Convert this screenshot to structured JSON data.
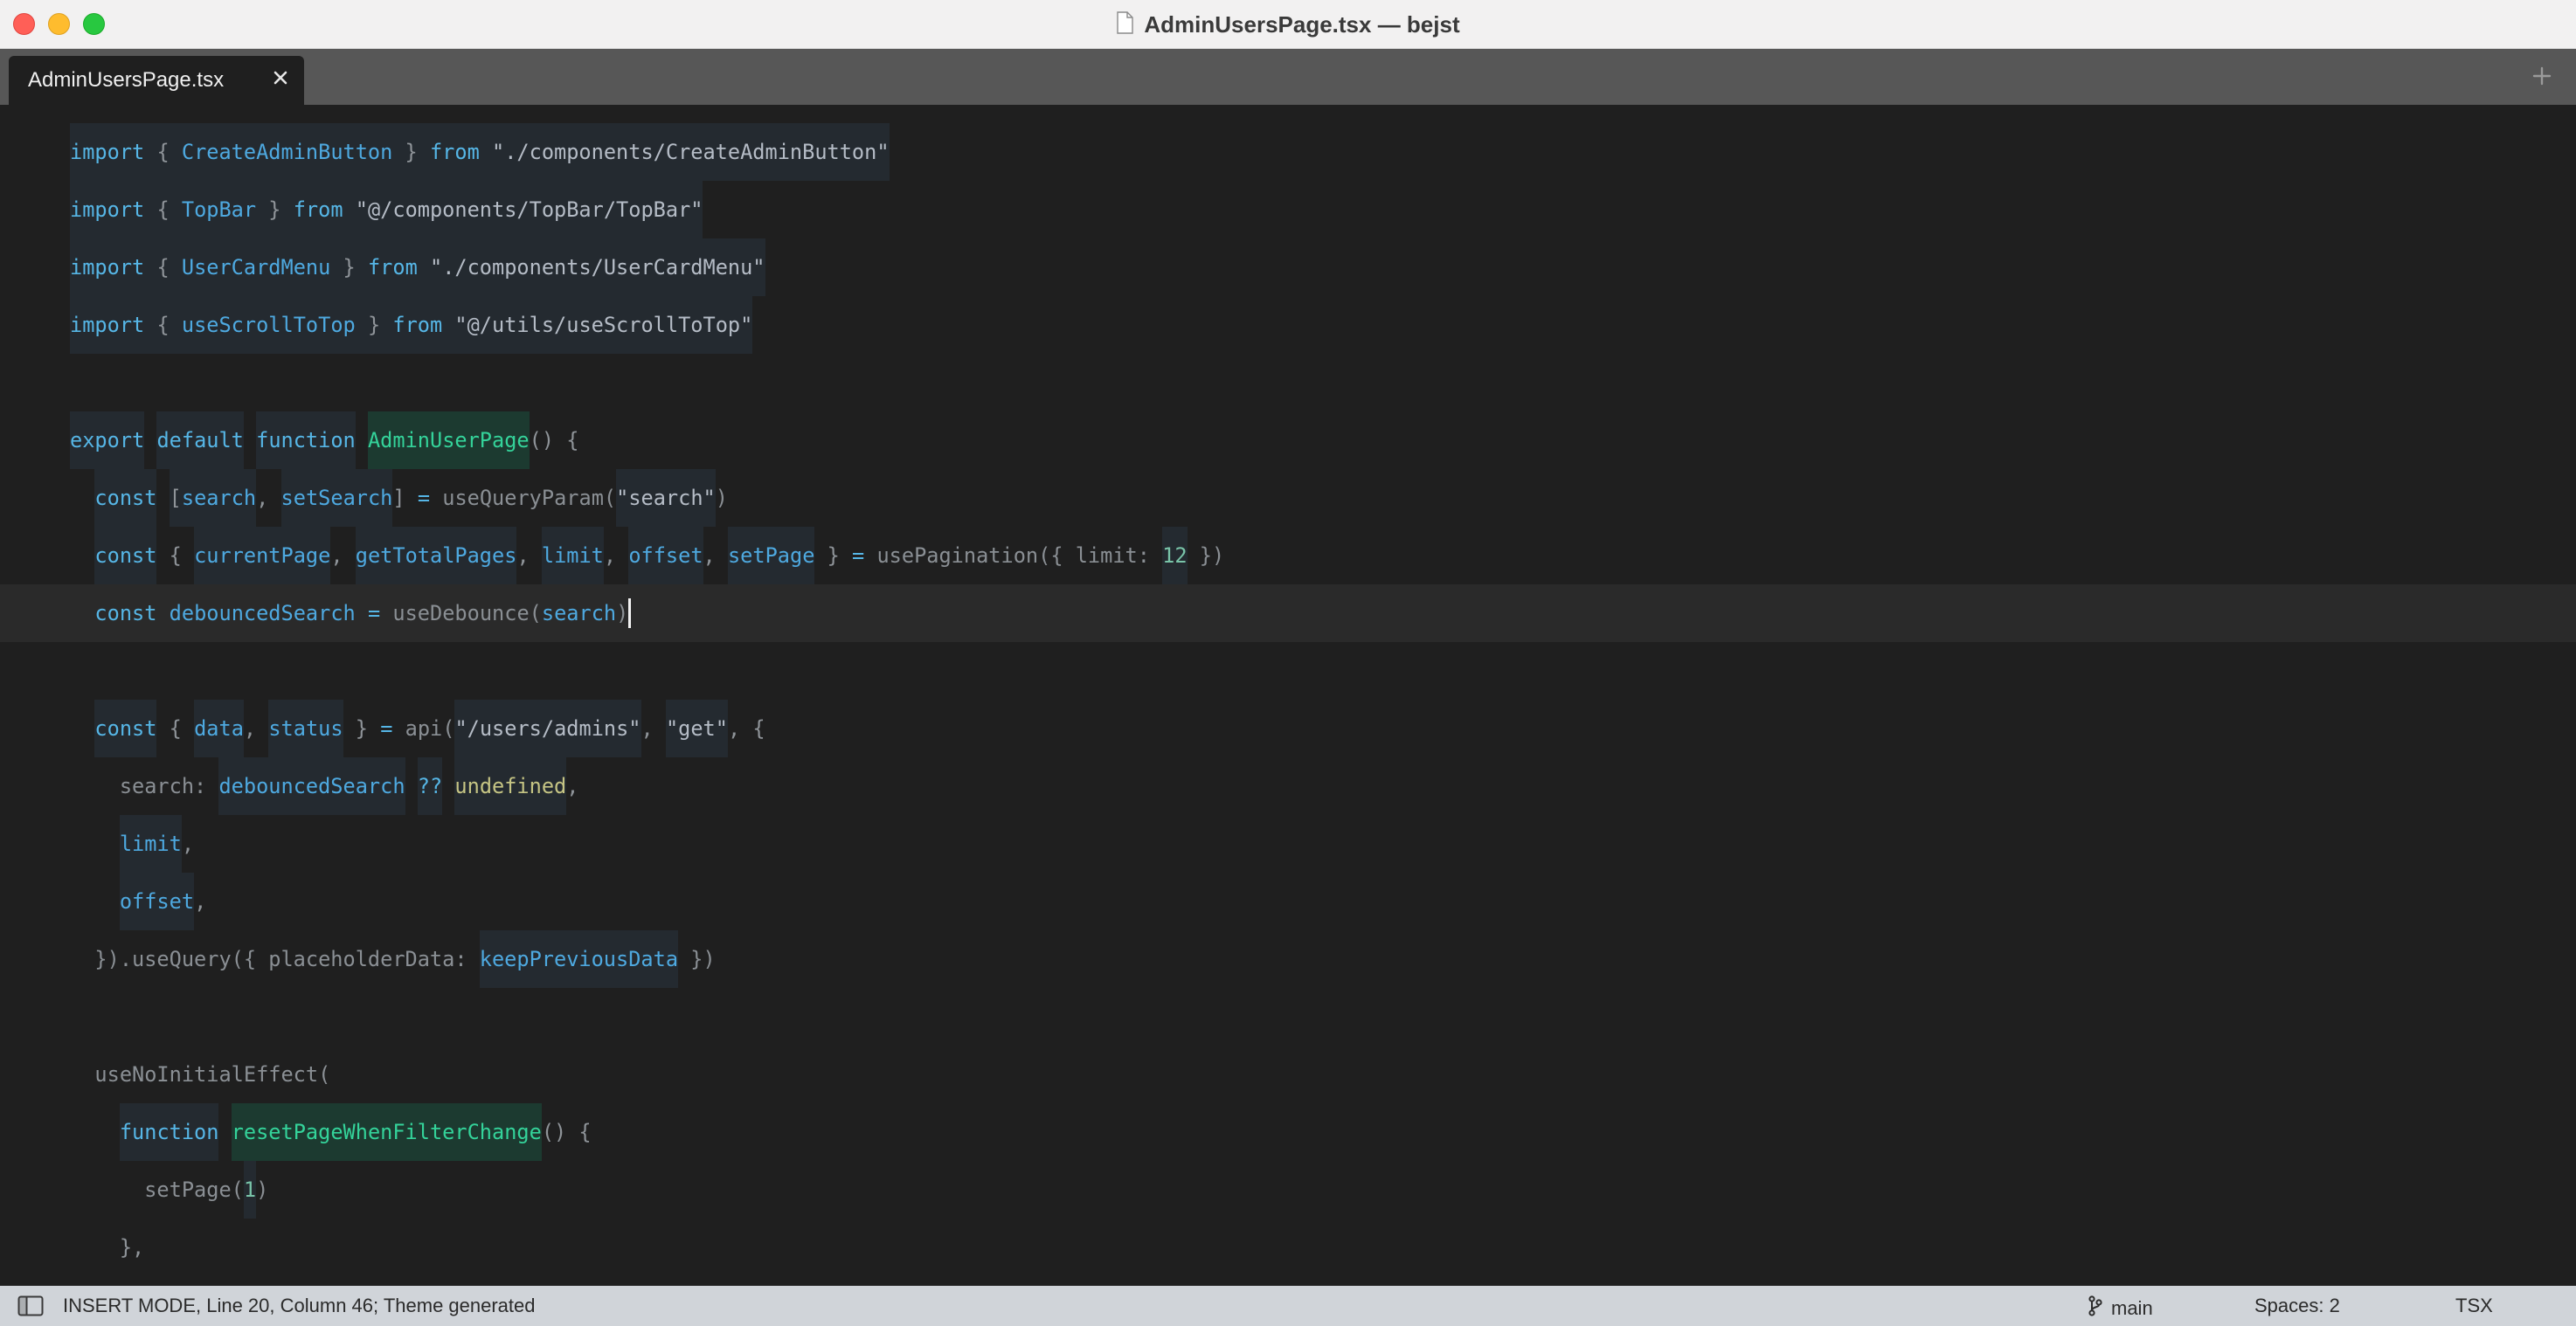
{
  "window": {
    "title": "AdminUsersPage.tsx — bejst"
  },
  "tabs": [
    {
      "label": "AdminUsersPage.tsx",
      "active": true
    }
  ],
  "icons": {
    "document": "document-icon",
    "tab_close": "close-icon",
    "new_tab": "plus-icon",
    "sidebar_toggle": "sidebar-icon",
    "branch": "git-branch-icon"
  },
  "theme": {
    "editor_background": "#1f1f1f",
    "current_line": "#2a2a2a",
    "keyword": "#56b6e6",
    "identifier": "#4ea9e0",
    "function_name": "#34d39a",
    "tab_bar": "#575757",
    "status_bar": "#d0d4d9"
  },
  "editor": {
    "lines": [
      {
        "tokens": [
          {
            "t": "import",
            "c": "kw",
            "h": "l"
          },
          {
            "t": " { ",
            "c": "punc",
            "h": "l"
          },
          {
            "t": "CreateAdminButton",
            "c": "id",
            "h": "l"
          },
          {
            "t": " } ",
            "c": "punc",
            "h": "l"
          },
          {
            "t": "from",
            "c": "kw",
            "h": "l"
          },
          {
            "t": " \"./components/CreateAdminButton\"",
            "c": "str",
            "h": "l"
          }
        ]
      },
      {
        "tokens": [
          {
            "t": "import",
            "c": "kw",
            "h": "l"
          },
          {
            "t": " { ",
            "c": "punc",
            "h": "l"
          },
          {
            "t": "TopBar",
            "c": "id",
            "h": "l"
          },
          {
            "t": " } ",
            "c": "punc",
            "h": "l"
          },
          {
            "t": "from",
            "c": "kw",
            "h": "l"
          },
          {
            "t": " \"@/components/TopBar/TopBar\"",
            "c": "str",
            "h": "l"
          }
        ]
      },
      {
        "tokens": [
          {
            "t": "import",
            "c": "kw",
            "h": "l"
          },
          {
            "t": " { ",
            "c": "punc",
            "h": "l"
          },
          {
            "t": "UserCardMenu",
            "c": "id",
            "h": "l"
          },
          {
            "t": " } ",
            "c": "punc",
            "h": "l"
          },
          {
            "t": "from",
            "c": "kw",
            "h": "l"
          },
          {
            "t": " \"./components/UserCardMenu\"",
            "c": "str",
            "h": "l"
          }
        ]
      },
      {
        "tokens": [
          {
            "t": "import",
            "c": "kw",
            "h": "l"
          },
          {
            "t": " { ",
            "c": "punc",
            "h": "l"
          },
          {
            "t": "useScrollToTop",
            "c": "id",
            "h": "l"
          },
          {
            "t": " } ",
            "c": "punc",
            "h": "l"
          },
          {
            "t": "from",
            "c": "kw",
            "h": "l"
          },
          {
            "t": " \"@/utils/useScrollToTop\"",
            "c": "str",
            "h": "l"
          }
        ]
      },
      {
        "tokens": []
      },
      {
        "tokens": [
          {
            "t": "export",
            "c": "kw",
            "h": "l"
          },
          {
            "t": " ",
            "c": "punc"
          },
          {
            "t": "default",
            "c": "kw",
            "h": "l"
          },
          {
            "t": " ",
            "c": "punc"
          },
          {
            "t": "function",
            "c": "kw",
            "h": "l"
          },
          {
            "t": " ",
            "c": "punc"
          },
          {
            "t": "AdminUserPage",
            "c": "fn",
            "h": "g"
          },
          {
            "t": "() {",
            "c": "punc"
          }
        ]
      },
      {
        "tokens": [
          {
            "t": "  ",
            "c": "punc"
          },
          {
            "t": "const",
            "c": "kw",
            "h": "l"
          },
          {
            "t": " ",
            "c": "punc"
          },
          {
            "t": "[",
            "c": "punc",
            "h": "l"
          },
          {
            "t": "search",
            "c": "id",
            "h": "l"
          },
          {
            "t": ", ",
            "c": "punc"
          },
          {
            "t": "setSearch",
            "c": "id",
            "h": "l"
          },
          {
            "t": "] ",
            "c": "punc"
          },
          {
            "t": "=",
            "c": "kw"
          },
          {
            "t": " useQueryParam(",
            "c": "dim"
          },
          {
            "t": "\"search\"",
            "c": "str",
            "h": "l"
          },
          {
            "t": ")",
            "c": "dim"
          }
        ]
      },
      {
        "tokens": [
          {
            "t": "  ",
            "c": "punc"
          },
          {
            "t": "const",
            "c": "kw",
            "h": "l"
          },
          {
            "t": " { ",
            "c": "punc"
          },
          {
            "t": "currentPage",
            "c": "id",
            "h": "l"
          },
          {
            "t": ", ",
            "c": "punc"
          },
          {
            "t": "getTotalPages",
            "c": "id",
            "h": "l"
          },
          {
            "t": ", ",
            "c": "punc"
          },
          {
            "t": "limit",
            "c": "id",
            "h": "l"
          },
          {
            "t": ", ",
            "c": "punc"
          },
          {
            "t": "offset",
            "c": "id",
            "h": "l"
          },
          {
            "t": ", ",
            "c": "punc"
          },
          {
            "t": "setPage",
            "c": "id",
            "h": "l"
          },
          {
            "t": " } ",
            "c": "punc"
          },
          {
            "t": "=",
            "c": "kw"
          },
          {
            "t": " usePagination({ limit: ",
            "c": "dim"
          },
          {
            "t": "12",
            "c": "num",
            "h": "l"
          },
          {
            "t": " })",
            "c": "dim"
          }
        ]
      },
      {
        "current": true,
        "caret": true,
        "tokens": [
          {
            "t": "  ",
            "c": "punc"
          },
          {
            "t": "const",
            "c": "kw"
          },
          {
            "t": " ",
            "c": "punc"
          },
          {
            "t": "debouncedSearch",
            "c": "id"
          },
          {
            "t": " ",
            "c": "punc"
          },
          {
            "t": "=",
            "c": "kw"
          },
          {
            "t": " useDebounce",
            "c": "dim"
          },
          {
            "t": "(",
            "c": "dim"
          },
          {
            "t": "search",
            "c": "id"
          },
          {
            "t": ")",
            "c": "dim"
          }
        ]
      },
      {
        "tokens": []
      },
      {
        "tokens": [
          {
            "t": "  ",
            "c": "punc"
          },
          {
            "t": "const",
            "c": "kw",
            "h": "l"
          },
          {
            "t": " { ",
            "c": "punc"
          },
          {
            "t": "data",
            "c": "id",
            "h": "l"
          },
          {
            "t": ", ",
            "c": "punc"
          },
          {
            "t": "status",
            "c": "id",
            "h": "l"
          },
          {
            "t": " } ",
            "c": "punc"
          },
          {
            "t": "=",
            "c": "kw"
          },
          {
            "t": " api(",
            "c": "dim"
          },
          {
            "t": "\"/users/admins\"",
            "c": "str",
            "h": "l"
          },
          {
            "t": ", ",
            "c": "punc"
          },
          {
            "t": "\"get\"",
            "c": "str",
            "h": "l"
          },
          {
            "t": ", {",
            "c": "punc"
          }
        ]
      },
      {
        "tokens": [
          {
            "t": "    search: ",
            "c": "dim"
          },
          {
            "t": "debouncedSearch",
            "c": "id",
            "h": "l"
          },
          {
            "t": " ",
            "c": "punc"
          },
          {
            "t": "??",
            "c": "kw",
            "h": "l"
          },
          {
            "t": " ",
            "c": "punc"
          },
          {
            "t": "undefined",
            "c": "undef",
            "h": "l"
          },
          {
            "t": ",",
            "c": "punc"
          }
        ]
      },
      {
        "tokens": [
          {
            "t": "    ",
            "c": "punc"
          },
          {
            "t": "limit",
            "c": "id",
            "h": "l"
          },
          {
            "t": ",",
            "c": "punc"
          }
        ]
      },
      {
        "tokens": [
          {
            "t": "    ",
            "c": "punc"
          },
          {
            "t": "offset",
            "c": "id",
            "h": "l"
          },
          {
            "t": ",",
            "c": "punc"
          }
        ]
      },
      {
        "tokens": [
          {
            "t": "  }).useQuery({ placeholderData: ",
            "c": "dim"
          },
          {
            "t": "keepPreviousData",
            "c": "id",
            "h": "l"
          },
          {
            "t": " })",
            "c": "dim"
          }
        ]
      },
      {
        "tokens": []
      },
      {
        "tokens": [
          {
            "t": "  useNoInitialEffect(",
            "c": "dim"
          }
        ]
      },
      {
        "tokens": [
          {
            "t": "    ",
            "c": "punc"
          },
          {
            "t": "function",
            "c": "kw",
            "h": "l"
          },
          {
            "t": " ",
            "c": "punc"
          },
          {
            "t": "resetPageWhenFilterChange",
            "c": "fn",
            "h": "g"
          },
          {
            "t": "() {",
            "c": "punc"
          }
        ]
      },
      {
        "tokens": [
          {
            "t": "      setPage(",
            "c": "dim"
          },
          {
            "t": "1",
            "c": "num",
            "h": "l"
          },
          {
            "t": ")",
            "c": "dim"
          }
        ]
      },
      {
        "tokens": [
          {
            "t": "    },",
            "c": "punc"
          }
        ]
      }
    ]
  },
  "statusbar": {
    "mode": "INSERT MODE, Line 20, Column 46; Theme generated",
    "branch": "main",
    "spaces": "Spaces: 2",
    "syntax": "TSX"
  }
}
